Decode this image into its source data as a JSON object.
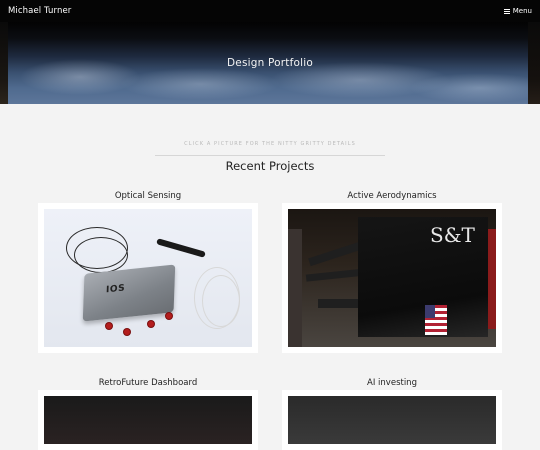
{
  "header": {
    "brand": "Michael Turner",
    "menu_label": "Menu",
    "menu_icon": "hamburger-icon"
  },
  "hero": {
    "title": "Design Portfolio"
  },
  "section": {
    "subtitle": "CLICK A PICTURE FOR THE NITTY GRITTY DETAILS",
    "title": "Recent Projects"
  },
  "projects": [
    {
      "title": "Optical Sensing",
      "image_label": "IOS"
    },
    {
      "title": "Active Aerodynamics",
      "image_label": "S&T"
    },
    {
      "title": "RetroFuture Dashboard"
    },
    {
      "title": "AI investing"
    }
  ]
}
